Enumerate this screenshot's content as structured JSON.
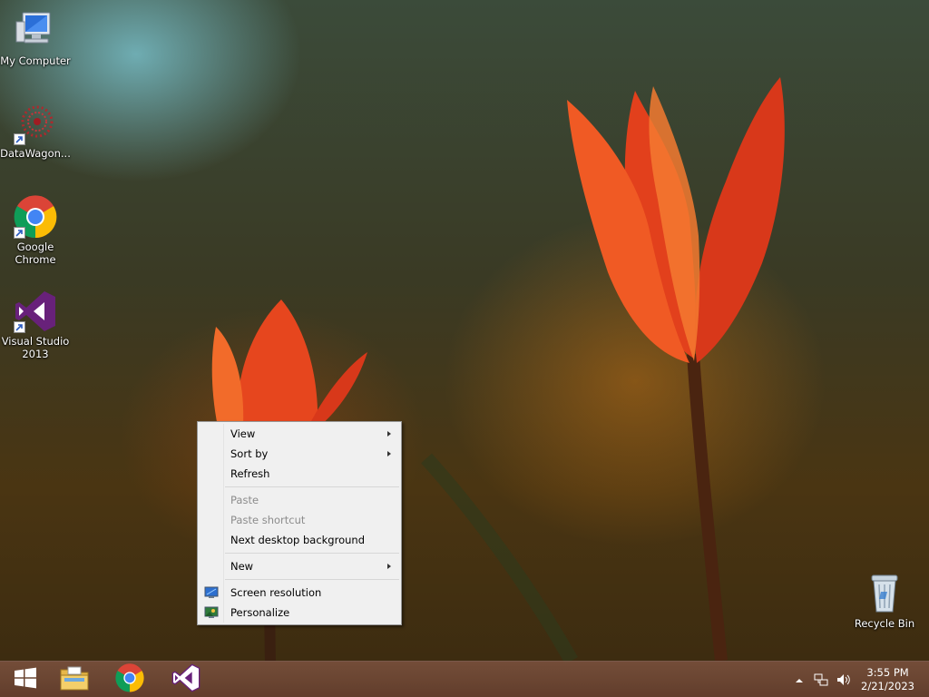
{
  "desktop_icons": {
    "my_computer": "My Computer",
    "datawagon": "DataWagon...",
    "chrome_line1": "Google",
    "chrome_line2": "Chrome",
    "vs_line1": "Visual Studio",
    "vs_line2": "2013",
    "recycle_bin": "Recycle Bin"
  },
  "context_menu": {
    "view": "View",
    "sort_by": "Sort by",
    "refresh": "Refresh",
    "paste": "Paste",
    "paste_shortcut": "Paste shortcut",
    "next_background": "Next desktop background",
    "new": "New",
    "screen_resolution": "Screen resolution",
    "personalize": "Personalize"
  },
  "taskbar": {
    "time": "3:55 PM",
    "date": "2/21/2023"
  },
  "icons": [
    "windows-start-icon",
    "file-explorer-icon",
    "chrome-icon",
    "visual-studio-icon",
    "show-hidden-icons-icon",
    "network-icon",
    "volume-icon"
  ]
}
